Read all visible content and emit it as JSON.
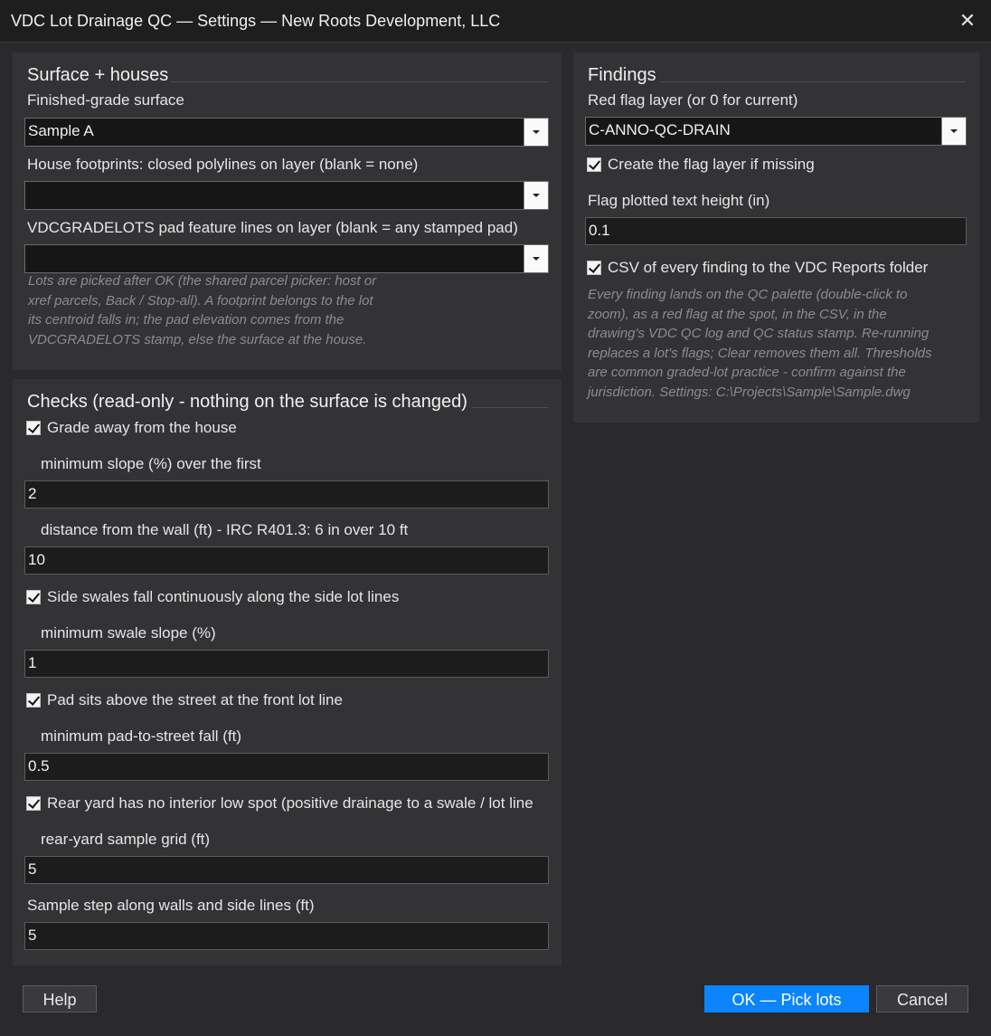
{
  "window": {
    "title": "VDC Lot Drainage QC — Settings — New Roots Development, LLC",
    "close_glyph": "✕"
  },
  "surface": {
    "title": "Surface + houses",
    "finished_grade_label": "Finished-grade surface",
    "finished_grade_value": "Sample A",
    "footprints_label": "House footprints: closed polylines on layer (blank = none)",
    "footprints_value": "",
    "pad_label": "VDCGRADELOTS pad feature lines on layer (blank = any stamped pad)",
    "pad_value": "",
    "note_lines": [
      "Lots are picked after OK (the shared parcel picker: host or",
      "xref parcels, Back / Stop-all). A footprint belongs to the lot",
      "its centroid falls in; the pad elevation comes from the",
      "VDCGRADELOTS stamp, else the surface at the house."
    ]
  },
  "findings": {
    "title": "Findings",
    "layer_label": "Red flag layer (or 0 for current)",
    "layer_value": "C-ANNO-QC-DRAIN",
    "create_layer_label": "Create the flag layer if missing",
    "create_layer_checked": true,
    "text_height_label": "Flag plotted text height (in)",
    "text_height_value": "0.1",
    "csv_label": "CSV of every finding to the VDC Reports folder",
    "csv_checked": true,
    "note_lines": [
      "Every finding lands on the QC palette (double-click to",
      "zoom), as a red flag at the spot, in the CSV, in the",
      "drawing's VDC QC log and QC status stamp. Re-running",
      "replaces a lot's flags; Clear removes them all. Thresholds",
      "are common graded-lot practice - confirm against the",
      "jurisdiction. Settings: C:\\Projects\\Sample\\Sample.dwg"
    ]
  },
  "checks": {
    "title": "Checks (read-only - nothing on the surface is changed)",
    "grade_away_label": "Grade away from the house",
    "grade_away_checked": true,
    "min_slope_label": "minimum slope (%) over the first",
    "min_slope_value": "2",
    "distance_label": "distance from the wall (ft) - IRC R401.3: 6 in over 10 ft",
    "distance_value": "10",
    "side_swales_label": "Side swales fall continuously along the side lot lines",
    "side_swales_checked": true,
    "min_swale_label": "minimum swale slope (%)",
    "min_swale_value": "1",
    "pad_above_label": "Pad sits above the street at the front lot line",
    "pad_above_checked": true,
    "min_pad_fall_label": "minimum pad-to-street fall (ft)",
    "min_pad_fall_value": "0.5",
    "rear_yard_label": "Rear yard has no interior low spot (positive drainage to a swale / lot line",
    "rear_yard_checked": true,
    "rear_grid_label": "rear-yard sample grid (ft)",
    "rear_grid_value": "5",
    "sample_step_label": "Sample step along walls and side lines (ft)",
    "sample_step_value": "5"
  },
  "buttons": {
    "help": "Help",
    "ok": "OK — Pick lots",
    "cancel": "Cancel"
  },
  "colors": {
    "accent": "#0a84ff",
    "panel": "#333336",
    "background": "#2a2a2d"
  }
}
